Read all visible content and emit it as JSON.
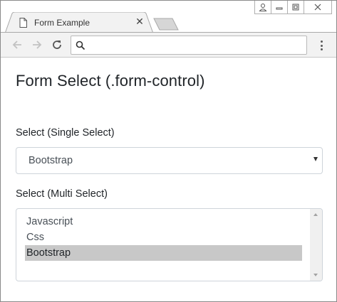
{
  "browser": {
    "tab_title": "Form Example",
    "tab_icon": "page-icon",
    "close_glyph": "✕",
    "address_value": "",
    "colors": {
      "tab_bg": "#f2f2f2",
      "toolbar_bg": "#f2f2f2",
      "border": "#a9a9a9"
    }
  },
  "page": {
    "title": "Form Select (.form-control)",
    "single_select": {
      "label": "Select (Single Select)",
      "selected": "Bootstrap"
    },
    "multi_select": {
      "label": "Select (Multi Select)",
      "options": [
        "Javascript",
        "Css",
        "Bootstrap"
      ],
      "selected": "Bootstrap",
      "selected_bg": "#c8c8c8"
    }
  }
}
